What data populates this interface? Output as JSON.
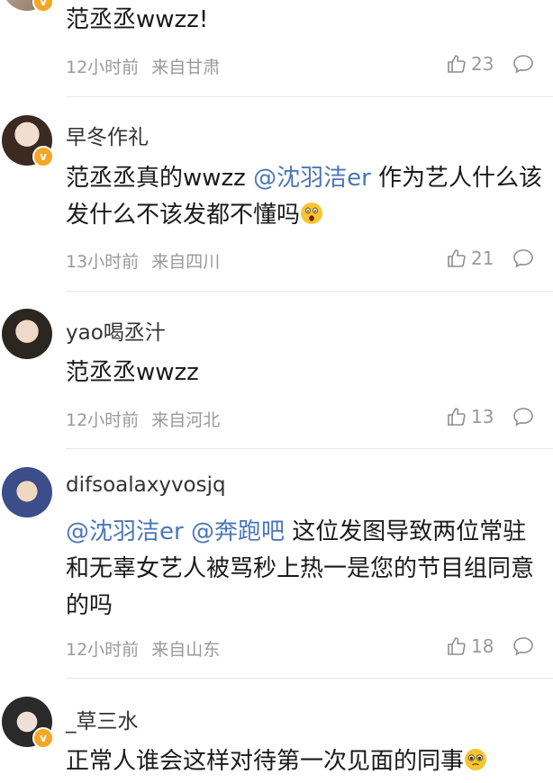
{
  "comments": [
    {
      "username": "",
      "text": "范丞丞wwzz!",
      "time": "12小时前",
      "location": "来自甘肃",
      "likes": "23",
      "verified": true
    },
    {
      "username": "早冬作礼",
      "text_prefix": "范丞丞真的wwzz ",
      "mention": "@沈羽洁er",
      "text_suffix": " 作为艺人什么该发什么不该发都不懂吗",
      "emoji": "shocked-face-emoji",
      "time": "13小时前",
      "location": "来自四川",
      "likes": "21",
      "verified": true
    },
    {
      "username": "yao喝丞汁",
      "text": "范丞丞wwzz",
      "time": "12小时前",
      "location": "来自河北",
      "likes": "13",
      "verified": false
    },
    {
      "username": "difsoalaxyvosjq",
      "mention1": "@沈羽洁er",
      "mention2": "@奔跑吧",
      "text_suffix": " 这位发图导致两位常驻和无辜女艺人被骂秒上热一是您的节目组同意的吗",
      "time": "12小时前",
      "location": "来自山东",
      "likes": "18",
      "verified": false
    },
    {
      "username": "_草三水",
      "text": "正常人谁会这样对待第一次见面的同事",
      "emoji": "pleading-face-emoji",
      "verified": true
    }
  ],
  "colors": {
    "mention": "#4a76b8",
    "meta": "#9a9a9a",
    "badge": "#f5a623"
  }
}
